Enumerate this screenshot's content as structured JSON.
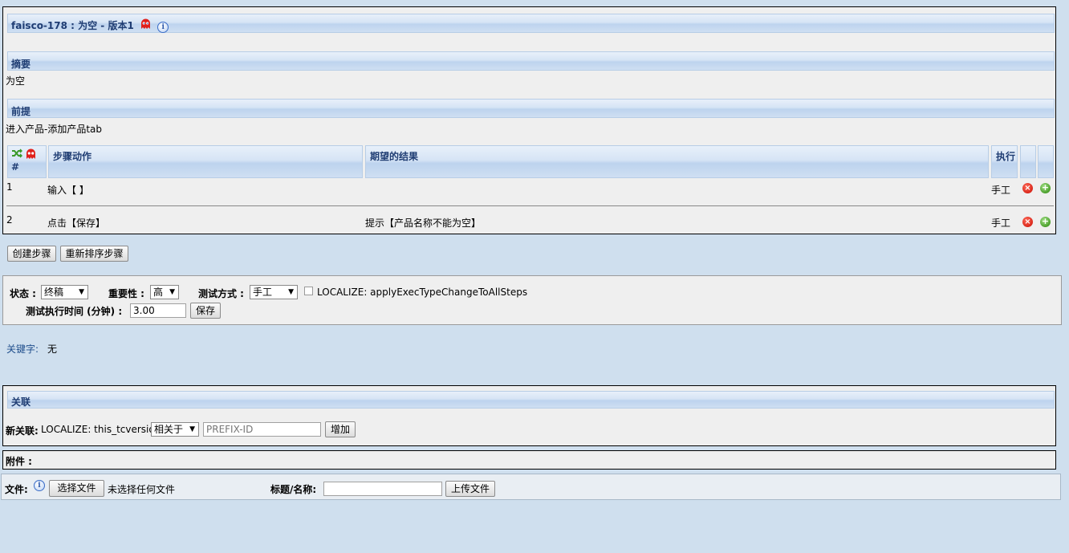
{
  "testcase": {
    "title": "faisco-178 : 为空 - 版本1",
    "summary_header": "摘要",
    "summary_text": "为空",
    "precondition_header": "前提",
    "precondition_text": "进入产品-添加产品tab"
  },
  "steps_table": {
    "headers": {
      "number": "#",
      "action": "步骤动作",
      "expected": "期望的结果",
      "exec": "执行"
    },
    "rows": [
      {
        "number": "1",
        "action": "输入【 】",
        "expected": "",
        "exec": "手工"
      },
      {
        "number": "2",
        "action": "点击【保存】",
        "expected": "提示【产品名称不能为空】",
        "exec": "手工"
      }
    ]
  },
  "step_buttons": {
    "create": "创建步骤",
    "reorder": "重新排序步骤"
  },
  "attributes": {
    "status_label": "状态 :",
    "status_value": "终稿",
    "importance_label": "重要性 :",
    "importance_value": "高",
    "exec_type_label": "测试方式 :",
    "exec_type_value": "手工",
    "apply_checkbox_label": "LOCALIZE: applyExecTypeChangeToAllSteps",
    "duration_label": "测试执行时间 (分钟) :",
    "duration_value": "3.00",
    "save_label": "保存"
  },
  "keywords": {
    "label": "关键字:",
    "value": "无"
  },
  "relations": {
    "header": "关联",
    "new_label": "新关联:",
    "this_label": "LOCALIZE: this_tcversion",
    "relation_type": "相关于",
    "prefix_placeholder": "PREFIX-ID",
    "add_label": "增加"
  },
  "attachments": {
    "header": "附件 :",
    "file_label": "文件:",
    "choose_file": "选择文件",
    "no_file": "未选择任何文件",
    "title_label": "标题/名称:",
    "title_value": "",
    "upload": "上传文件"
  },
  "colors": {
    "page_bg": "#cfdfee",
    "panel_bg": "#efefef",
    "header_text": "#1f3d73",
    "link_blue": "#1f4e8c"
  }
}
